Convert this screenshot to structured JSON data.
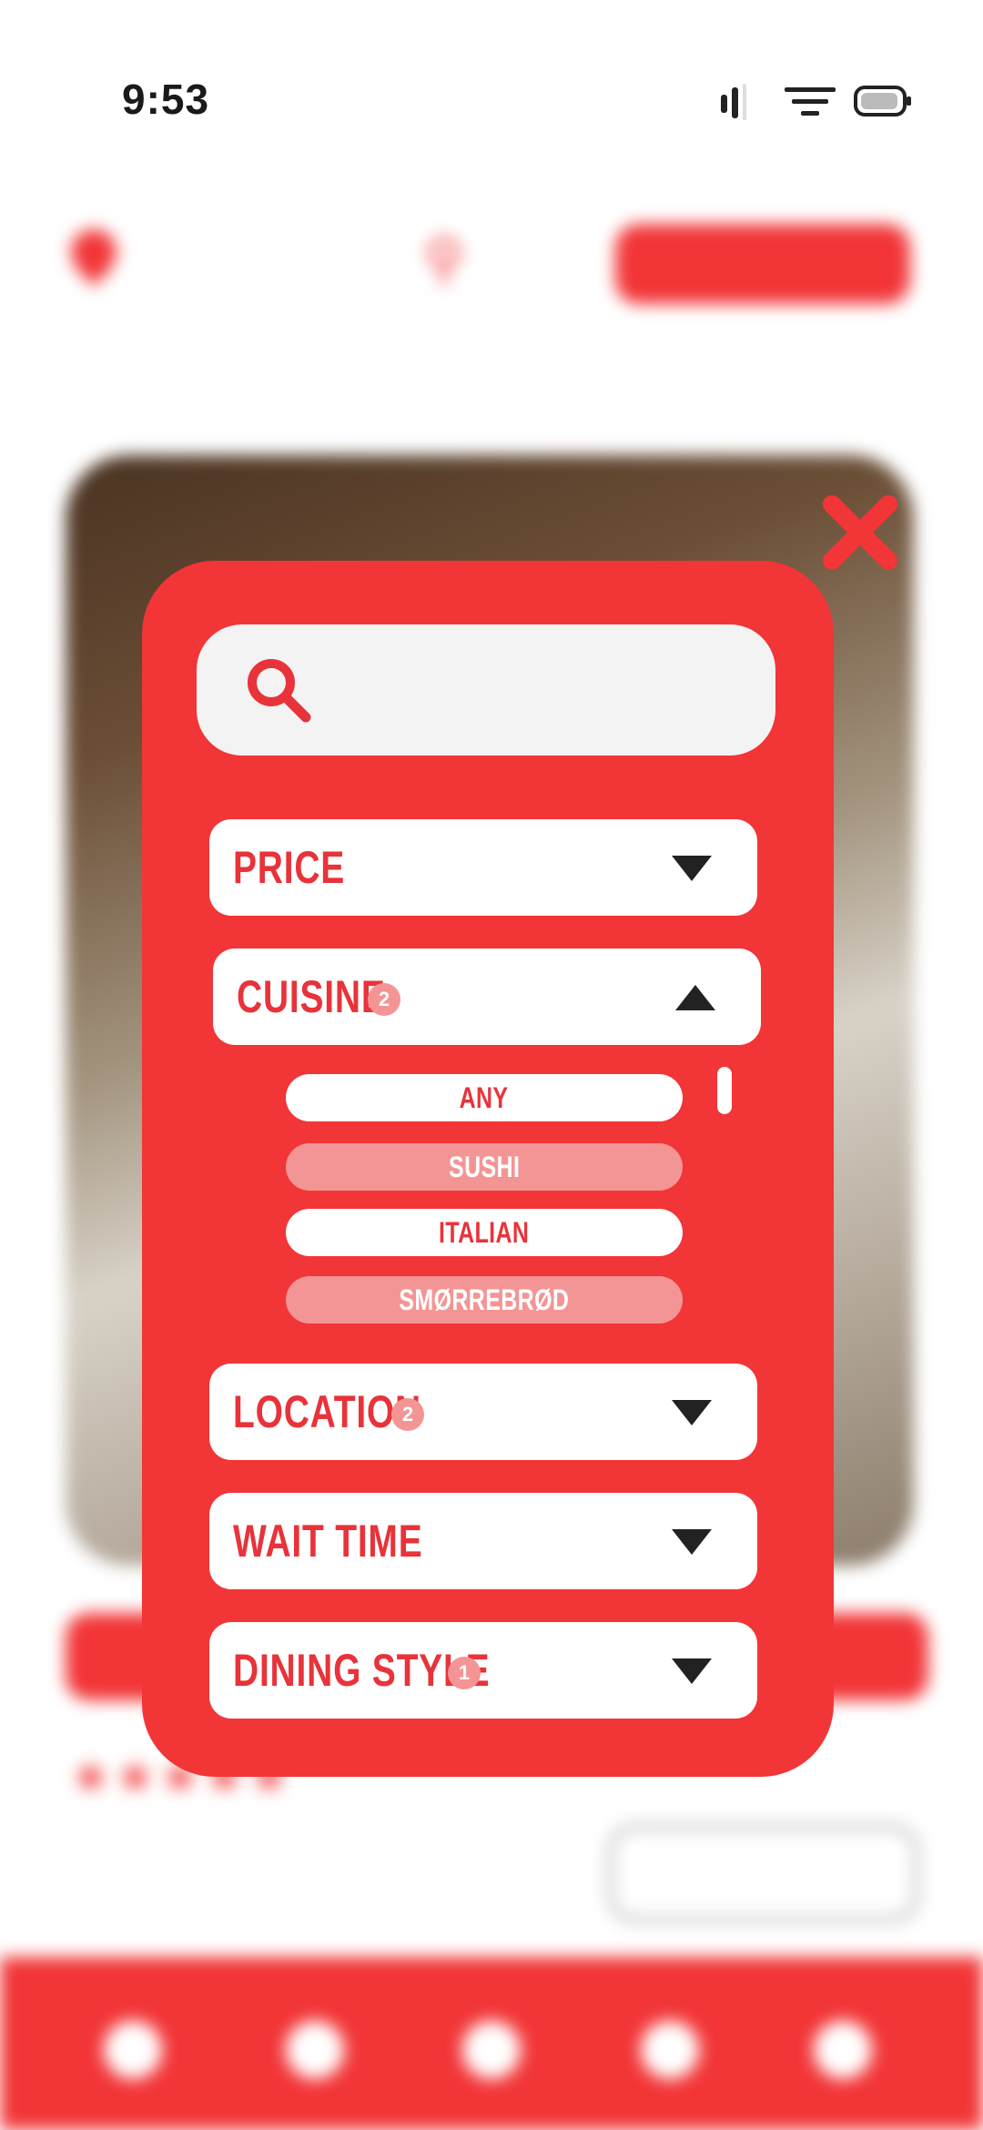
{
  "status_bar": {
    "time": "9:53"
  },
  "filter_modal": {
    "filters": {
      "price": {
        "label": "PRICE",
        "expanded": false
      },
      "cuisine": {
        "label": "CUISINE",
        "count": "2",
        "expanded": true,
        "options": [
          {
            "label": "ANY",
            "selected": false
          },
          {
            "label": "SUSHI",
            "selected": true
          },
          {
            "label": "ITALIAN",
            "selected": false
          },
          {
            "label": "SMØRREBRØD",
            "selected": true
          }
        ]
      },
      "location": {
        "label": "LOCATION",
        "count": "2",
        "expanded": false
      },
      "wait_time": {
        "label": "WAIT TIME",
        "expanded": false
      },
      "dining_style": {
        "label": "DINING STYLE",
        "count": "1",
        "expanded": false
      }
    }
  },
  "colors": {
    "accent": "#f23537",
    "selected_option": "#f49595",
    "search_field": "#f3f3f3"
  }
}
